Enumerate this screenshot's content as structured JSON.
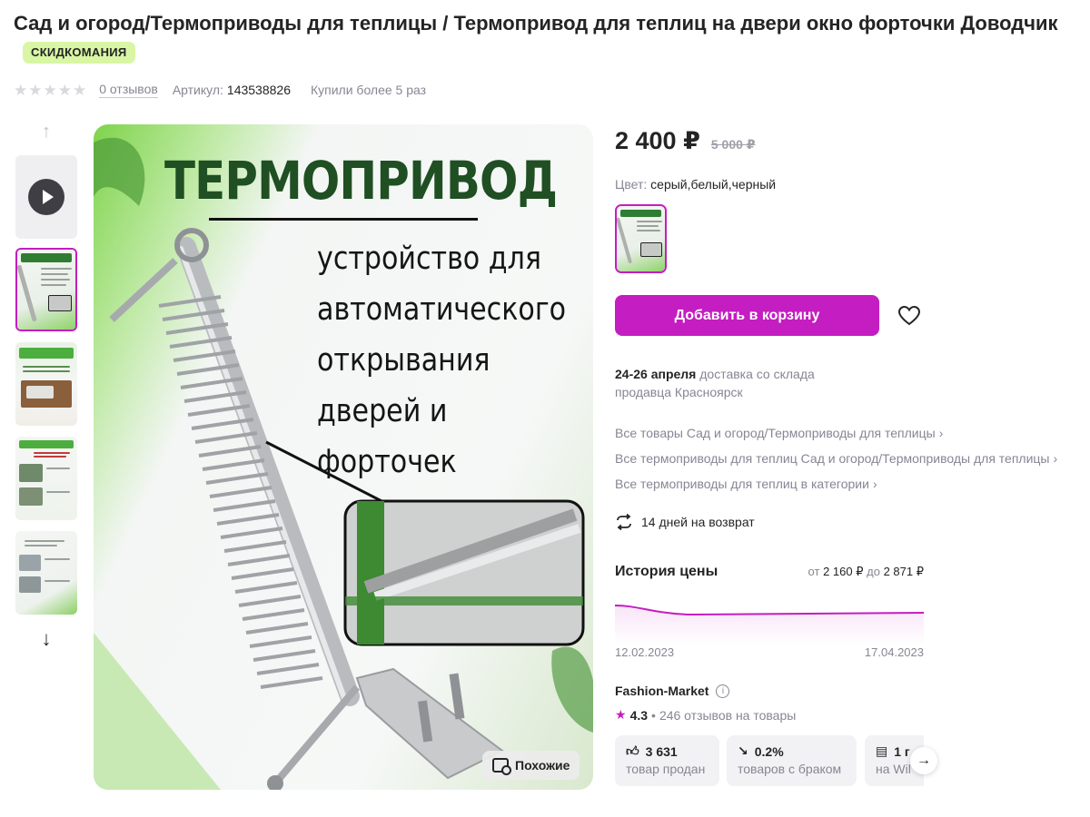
{
  "product": {
    "title": "Сад и огород/Термоприводы для теплицы / Термопривод для теплиц на двери окно форточки Доводчик",
    "badge": "СКИДКОМАНИЯ",
    "reviews": "0 отзывов",
    "article_label": "Артикул:",
    "article": "143538826",
    "bought": "Купили более 5 раз",
    "rating_stars": 0
  },
  "gallery": {
    "image_title": "ТЕРМОПРИВОД",
    "image_text_lines": [
      "устройство для",
      "автоматического",
      "открывания",
      "дверей и форточек"
    ],
    "similar_label": "Похожие",
    "thumb_count": 5,
    "active_thumb": 1
  },
  "pricing": {
    "price": "2 400 ₽",
    "old_price": "5 000 ₽",
    "color_label": "Цвет:",
    "color_value": "серый,белый,черный",
    "add_to_cart": "Добавить в корзину"
  },
  "delivery": {
    "dates": "24-26 апреля",
    "text": "доставка со склада продавца Красноярск"
  },
  "links": [
    "Все товары Сад и огород/Термоприводы для теплицы",
    "Все термоприводы для теплиц Сад и огород/Термоприводы для теплицы",
    "Все термоприводы для теплиц в категории"
  ],
  "returns": "14 дней на возврат",
  "price_history": {
    "title": "История цены",
    "from_label": "от",
    "from": "2 160 ₽",
    "to_label": "до",
    "to": "2 871 ₽",
    "start_date": "12.02.2023",
    "end_date": "17.04.2023",
    "line_color": "#c41dc1"
  },
  "seller": {
    "name": "Fashion-Market",
    "rating": "4.3",
    "reviews": "246 отзывов на товары"
  },
  "stats": [
    {
      "icon": "thumbs-up-icon",
      "value": "3 631",
      "label": "товар продан"
    },
    {
      "icon": "trend-down-icon",
      "value": "0.2%",
      "label": "товаров с браком"
    },
    {
      "icon": "store-icon",
      "value": "1 г",
      "label": "на Wil"
    }
  ],
  "colors": {
    "accent": "#c41dc1",
    "badge_bg": "#d8f6a4",
    "muted": "#868695"
  }
}
